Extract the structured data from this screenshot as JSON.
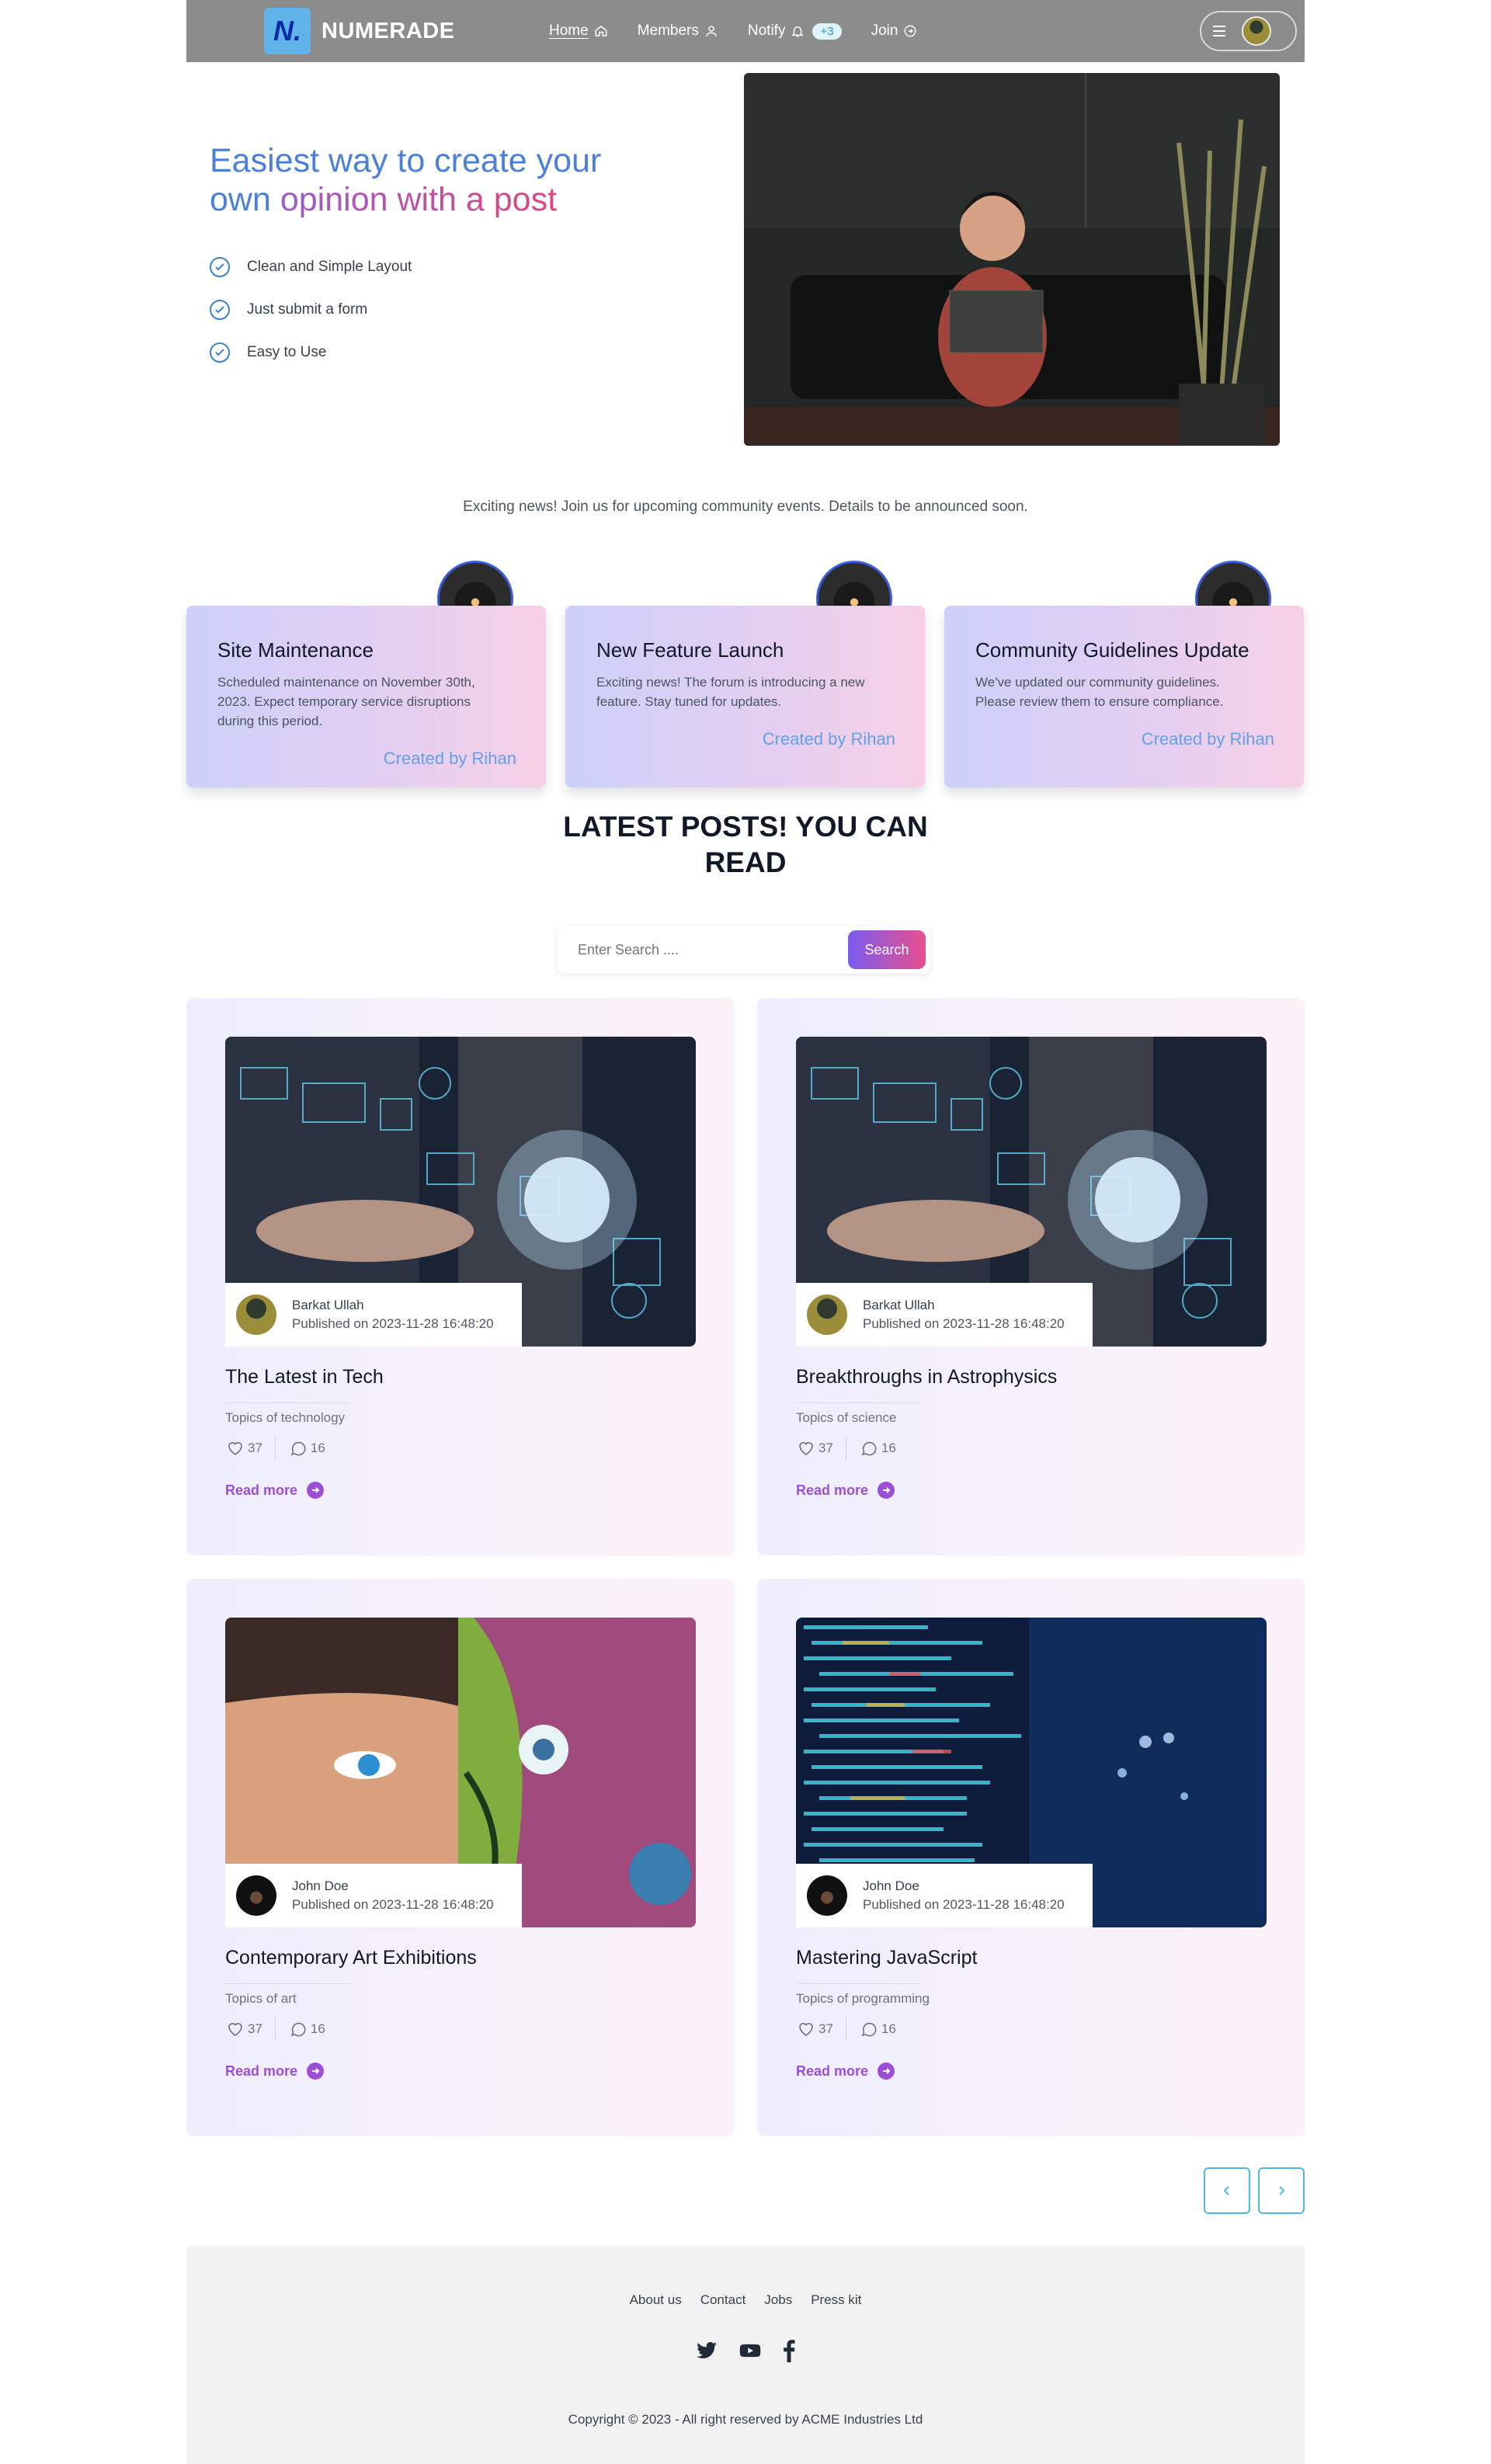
{
  "nav": {
    "logo_mark": "N.",
    "brand": "NUMERADE",
    "links": [
      {
        "label": "Home"
      },
      {
        "label": "Members"
      },
      {
        "label": "Notify",
        "badge": "+3"
      },
      {
        "label": "Join"
      }
    ]
  },
  "hero": {
    "title_line1": "Easiest way to create your",
    "title_line2_a": "own",
    "title_line2_b": "opinion with a post",
    "features": [
      "Clean and Simple Layout",
      "Just submit a form",
      "Easy to Use"
    ]
  },
  "announcement": "Exciting news! Join us for upcoming community events. Details to be announced soon.",
  "info_cards": [
    {
      "title": "Site Maintenance",
      "description": "Scheduled maintenance on November 30th, 2023. Expect temporary service disruptions during this period.",
      "by": "Created by Rihan"
    },
    {
      "title": "New Feature Launch",
      "description": "Exciting news! The forum is introducing a new feature. Stay tuned for updates.",
      "by": "Created by Rihan"
    },
    {
      "title": "Community Guidelines Update",
      "description": "We've updated our community guidelines. Please review them to ensure compliance.",
      "by": "Created by Rihan"
    }
  ],
  "section_title_line1": "LATEST POSTS! YOU CAN",
  "section_title_line2": "READ",
  "search": {
    "placeholder": "Enter Search ....",
    "button": "Search"
  },
  "posts": [
    {
      "author": "Barkat Ullah",
      "date": "Published on 2023-11-28 16:48:20",
      "title": "The Latest in Tech",
      "topic": "Topics of technology",
      "likes": "37",
      "comments": "16",
      "read_more": "Read more",
      "image": "tech"
    },
    {
      "author": "Barkat Ullah",
      "date": "Published on 2023-11-28 16:48:20",
      "title": "Breakthroughs in Astrophysics",
      "topic": "Topics of science",
      "likes": "37",
      "comments": "16",
      "read_more": "Read more",
      "image": "tech"
    },
    {
      "author": "John Doe",
      "date": "Published on 2023-11-28 16:48:20",
      "title": "Contemporary Art Exhibitions",
      "topic": "Topics of art",
      "likes": "37",
      "comments": "16",
      "read_more": "Read more",
      "image": "art"
    },
    {
      "author": "John Doe",
      "date": "Published on 2023-11-28 16:48:20",
      "title": "Mastering JavaScript",
      "topic": "Topics of programming",
      "likes": "37",
      "comments": "16",
      "read_more": "Read more",
      "image": "code"
    }
  ],
  "footer": {
    "links": [
      "About us",
      "Contact",
      "Jobs",
      "Press kit"
    ],
    "social": [
      "twitter-icon",
      "youtube-icon",
      "facebook-icon"
    ],
    "copyright": "Copyright © 2023 - All right reserved by ACME Industries Ltd"
  },
  "colors": {
    "nav_bg": "#8c8c8c",
    "accent_blue": "#4c7fd8",
    "accent_pink": "#e0457f",
    "read_more": "#9b4fd8",
    "created_by": "#64a0ea"
  }
}
